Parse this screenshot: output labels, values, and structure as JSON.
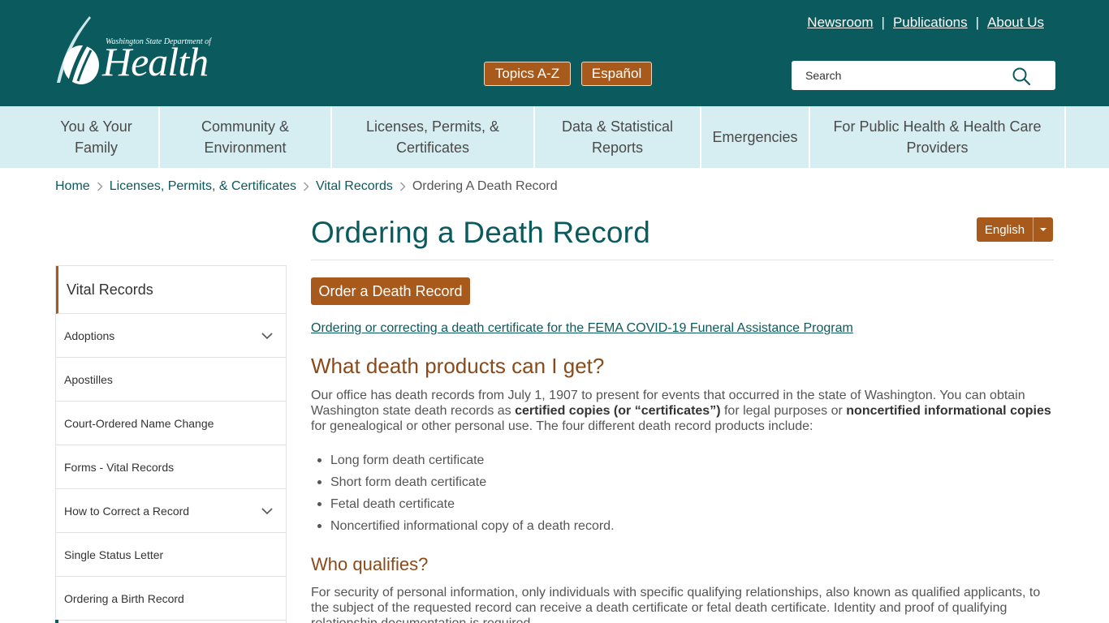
{
  "header": {
    "logo_subtitle": "Washington State Department of",
    "logo_title": "Health",
    "utility_links": [
      "Newsroom",
      "Publications",
      "About Us"
    ],
    "utility_separator": "|",
    "topics_button": "Topics A-Z",
    "espanol_button": "Español",
    "search_placeholder": "Search"
  },
  "nav": {
    "items": [
      "You & Your Family",
      "Community & Environment",
      "Licenses, Permits, & Certificates",
      "Data & Statistical Reports",
      "Emergencies",
      "For Public Health & Health Care Providers"
    ]
  },
  "breadcrumb": {
    "items": [
      "Home",
      "Licenses, Permits, & Certificates",
      "Vital Records"
    ],
    "current": "Ordering A Death Record"
  },
  "page": {
    "title": "Ordering a Death Record",
    "language": "English",
    "order_button": "Order a Death Record",
    "fema_link": "Ordering or correcting a death certificate for the FEMA COVID-19 Funeral Assistance Program",
    "heading_products": "What death products can I get?",
    "para1": {
      "part1": "Our office has death records from July 1, 1907 to present for events that occurred in the state of Washington. You can obtain Washington state death records as ",
      "bold1": "certified copies (or “certificates”)",
      "part2": " for legal purposes or ",
      "bold2": "noncertified informational copies",
      "part3": " for genealogical or other personal use. The four different death record products include:"
    },
    "products": [
      "Long form death certificate",
      "Short form death certificate",
      "Fetal death certificate",
      "Noncertified informational copy of a death record."
    ],
    "heading_qualifies": "Who qualifies?",
    "para2": "For security of personal information, only individuals with specific qualifying relationships, also known as qualified applicants, to the subject of the requested record can receive a death certificate or fetal death certificate. Identity and proof of qualifying relationship documentation is required."
  },
  "sidebar": {
    "heading": "Vital Records",
    "items": [
      "Adoptions",
      "Apostilles",
      "Court-Ordered Name Change",
      "Forms - Vital Records",
      "How to Correct a Record",
      "Single Status Letter",
      "Ordering a Birth Record"
    ]
  },
  "colors": {
    "brand_teal": "#0b5a5e",
    "accent_brown": "#a85a1c",
    "nav_bg": "#d6edf2",
    "heading_brown": "#8a4a1a"
  },
  "icons": {
    "search": "search-icon",
    "chevron_right": "chevron-right-icon",
    "chevron_down": "chevron-down-icon",
    "caret_down": "caret-down-icon"
  }
}
